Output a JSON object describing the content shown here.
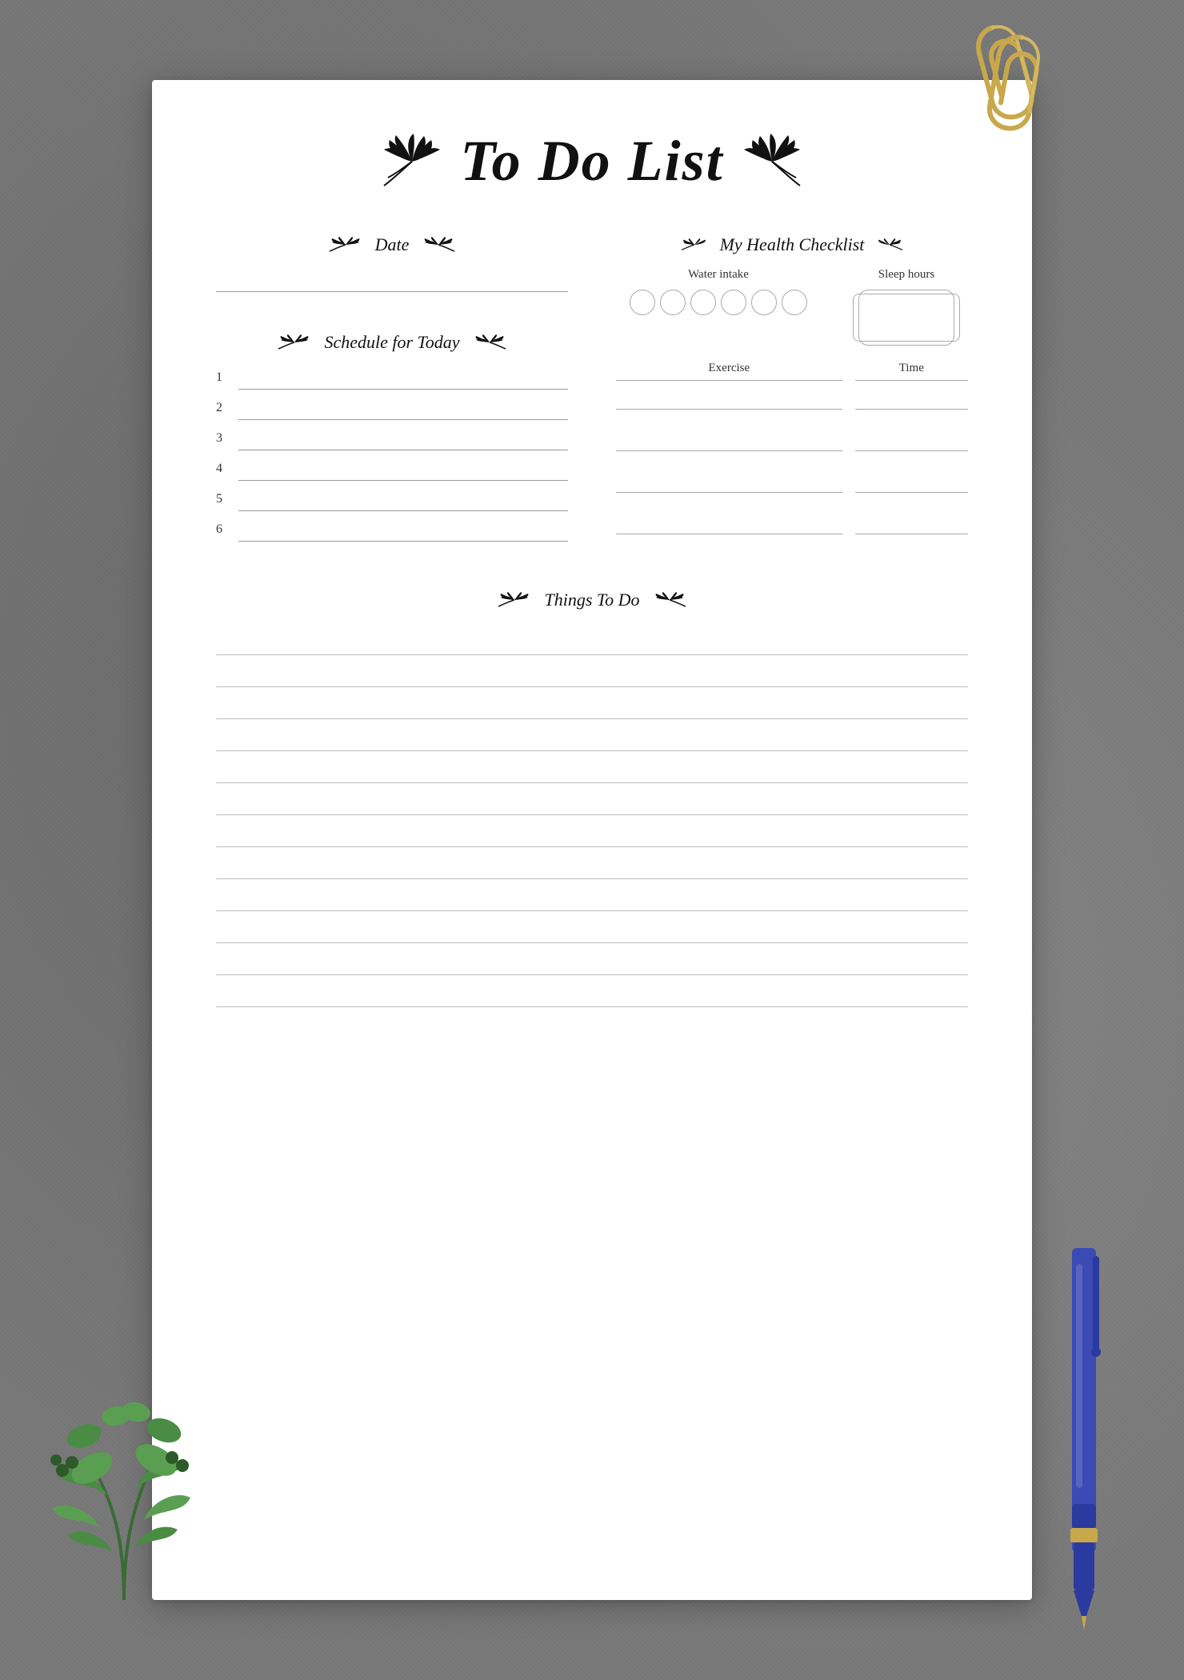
{
  "page": {
    "background_color": "#7a7a7a"
  },
  "paper": {
    "title": "To Do List",
    "sections": {
      "date": {
        "label": "Date",
        "wreath_left": "🌿",
        "wreath_right": "🌿"
      },
      "schedule": {
        "label": "Schedule for Today",
        "items": [
          "1",
          "2",
          "3",
          "4",
          "5",
          "6"
        ]
      },
      "health_checklist": {
        "label": "My Health Checklist",
        "water_intake_label": "Water intake",
        "sleep_hours_label": "Sleep hours",
        "exercise_label": "Exercise",
        "time_label": "Time",
        "water_circles_count": 6,
        "exercise_rows": 4
      },
      "things_to_do": {
        "label": "Things To Do",
        "lines_count": 12
      }
    }
  }
}
